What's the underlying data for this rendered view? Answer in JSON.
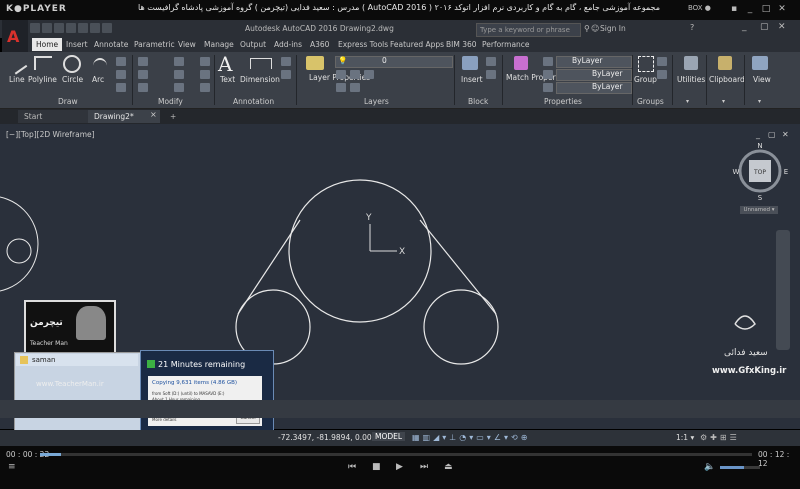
{
  "player": {
    "logo": "K●PLAYER",
    "title": "مجموعه آموزشی جامع ، گام به گام و کاربردی نرم افزار  اتوکد ۲۰۱۶ ( AutoCAD  2016 )  مدرس : سعید فدایی (تیچرمن ) گروه آموزشی پادشاه گرافیست ها",
    "box_label": "BOX ●",
    "time_current": "00 : 00 : 22",
    "time_total": "00 : 12 : 12",
    "progress": 0.03,
    "volume": 0.6
  },
  "app": {
    "doc_title": "Autodesk AutoCAD 2016    Drawing2.dwg",
    "search_placeholder": "Type a keyword or phrase",
    "signin": "Sign In"
  },
  "ribbon": {
    "tabs": [
      "Home",
      "Insert",
      "Annotate",
      "Parametric",
      "View",
      "Manage",
      "Output",
      "Add-ins",
      "A360",
      "Express Tools",
      "Featured Apps",
      "BIM 360",
      "Performance"
    ],
    "draw_tools": [
      "Line",
      "Polyline",
      "Circle",
      "Arc"
    ],
    "text_label": "Text",
    "dimension_label": "Dimension",
    "layer_properties_label": "Layer Properties",
    "layer_current": "0",
    "insert_label": "Insert",
    "match_properties_label": "Match Properties",
    "bylayer_values": [
      "ByLayer",
      "ByLayer",
      "ByLayer"
    ],
    "group_label": "Group",
    "utilities_label": "Utilities",
    "clipboard_label": "Clipboard",
    "view_label": "View",
    "panel_titles": [
      "Draw",
      "Modify",
      "Annotation",
      "Layers",
      "Block",
      "Properties",
      "Groups"
    ]
  },
  "file_tabs": {
    "start": "Start",
    "drawing": "Drawing2*",
    "close": "×",
    "plus": "+"
  },
  "viewport": {
    "label": "[−][Top][2D Wireframe]",
    "viewcube": {
      "top": "TOP",
      "n": "N",
      "s": "S",
      "e": "E",
      "w": "W",
      "unnamed": "Unnamed ▾"
    },
    "ucs_x": "X",
    "ucs_y": "Y"
  },
  "overlay": {
    "teacher_logo": "تیچرمن",
    "teacher_sub": "Teacher Man",
    "thumb_title": "saman",
    "thumb_url": "www.TeacherMan.ir",
    "copy_remaining": "21 Minutes remaining",
    "copy_heading": "Copying 9,631 items (4.86 GB)",
    "copy_line1": "from Soft (D:) (until) to MASAVD (E:)",
    "copy_line2": "About 1 Hour remaining",
    "copy_progress": 0.3,
    "copy_more": "More details",
    "copy_cancel": "Cancel",
    "watermark_name": "سعید فدائی",
    "watermark_site": "www.GfxKing.ir"
  },
  "status": {
    "coords": "-72.3497, -81.9894, 0.0000",
    "model": "MODEL",
    "scale": "1:1 ▾"
  }
}
